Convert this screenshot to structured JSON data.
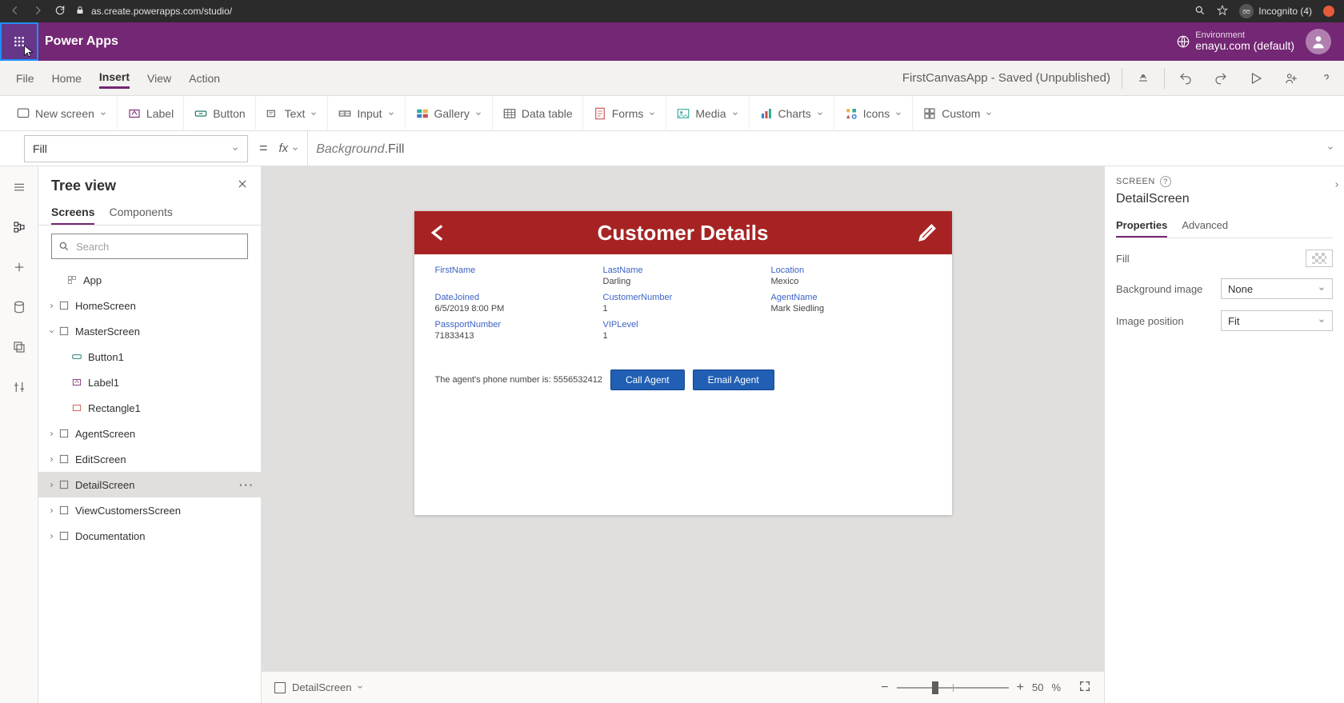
{
  "browser": {
    "url": "as.create.powerapps.com/studio/",
    "incognito_label": "Incognito (4)"
  },
  "app_bar": {
    "title": "Power Apps",
    "env_label": "Environment",
    "env_value": "enayu.com (default)"
  },
  "menus": {
    "file": "File",
    "home": "Home",
    "insert": "Insert",
    "view": "View",
    "action": "Action",
    "status": "FirstCanvasApp - Saved (Unpublished)"
  },
  "ribbon": {
    "new_screen": "New screen",
    "label": "Label",
    "button": "Button",
    "text": "Text",
    "input": "Input",
    "gallery": "Gallery",
    "data_table": "Data table",
    "forms": "Forms",
    "media": "Media",
    "charts": "Charts",
    "icons": "Icons",
    "custom": "Custom"
  },
  "formula": {
    "property": "Fill",
    "fx": "fx",
    "expr_obj": "Background",
    "expr_prop": ".Fill"
  },
  "tree": {
    "title": "Tree view",
    "tab_screens": "Screens",
    "tab_components": "Components",
    "search_placeholder": "Search",
    "items": {
      "app": "App",
      "home": "HomeScreen",
      "master": "MasterScreen",
      "button1": "Button1",
      "label1": "Label1",
      "rect1": "Rectangle1",
      "agent": "AgentScreen",
      "edit": "EditScreen",
      "detail": "DetailScreen",
      "view": "ViewCustomersScreen",
      "doc": "Documentation"
    }
  },
  "canvas": {
    "header": "Customer Details",
    "fields": {
      "first_name_l": "FirstName",
      "first_name_v": "",
      "last_name_l": "LastName",
      "last_name_v": "Darling",
      "location_l": "Location",
      "location_v": "Mexico",
      "date_joined_l": "DateJoined",
      "date_joined_v": "6/5/2019 8:00 PM",
      "cust_num_l": "CustomerNumber",
      "cust_num_v": "1",
      "agent_name_l": "AgentName",
      "agent_name_v": "Mark Siedling",
      "passport_l": "PassportNumber",
      "passport_v": "71833413",
      "vip_l": "VIPLevel",
      "vip_v": "1"
    },
    "agent_phone_label": "The agent's phone number is:  5556532412",
    "btn_call": "Call Agent",
    "btn_email": "Email Agent",
    "footer_name": "DetailScreen",
    "zoom_value": "50",
    "zoom_unit": "%"
  },
  "props": {
    "crumb": "SCREEN",
    "name": "DetailScreen",
    "tab_props": "Properties",
    "tab_adv": "Advanced",
    "row_fill": "Fill",
    "row_bg": "Background image",
    "row_bg_val": "None",
    "row_pos": "Image position",
    "row_pos_val": "Fit"
  }
}
